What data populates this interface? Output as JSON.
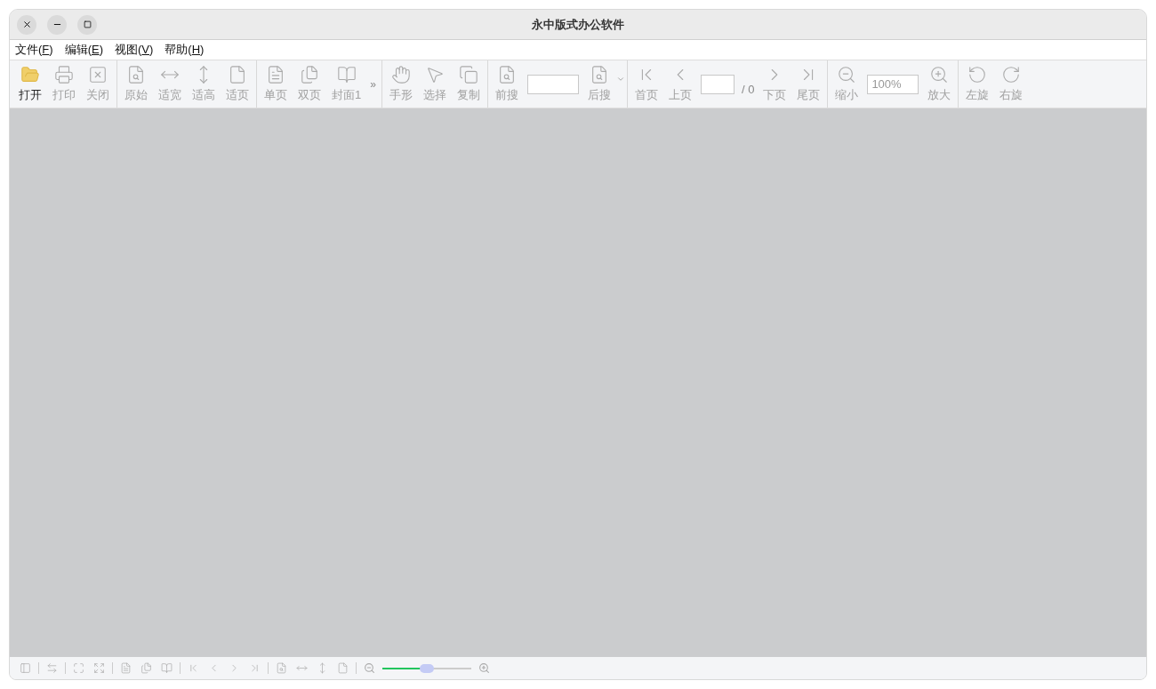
{
  "window": {
    "title": "永中版式办公软件"
  },
  "menu": [
    {
      "label": "文件(",
      "mnemonic": "F",
      "tail": ")"
    },
    {
      "label": "编辑(",
      "mnemonic": "E",
      "tail": ")"
    },
    {
      "label": "视图(",
      "mnemonic": "V",
      "tail": ")"
    },
    {
      "label": "帮助(",
      "mnemonic": "H",
      "tail": ")"
    }
  ],
  "toolbar": [
    [
      {
        "kind": "button",
        "label": "打开",
        "disabled": false
      },
      {
        "kind": "button",
        "label": "打印",
        "disabled": true
      },
      {
        "kind": "button",
        "label": "关闭",
        "disabled": true
      }
    ],
    [
      {
        "kind": "button",
        "label": "原始",
        "disabled": true
      },
      {
        "kind": "button",
        "label": "适宽",
        "disabled": true
      },
      {
        "kind": "button",
        "label": "适高",
        "disabled": true
      },
      {
        "kind": "button",
        "label": "适页",
        "disabled": true
      }
    ],
    [
      {
        "kind": "button",
        "label": "单页",
        "disabled": true
      },
      {
        "kind": "button",
        "label": "双页",
        "disabled": true
      },
      {
        "kind": "button",
        "label": "封面1",
        "disabled": true
      },
      {
        "kind": "more",
        "label": "»"
      }
    ],
    [
      {
        "kind": "button",
        "label": "手形",
        "disabled": true
      },
      {
        "kind": "button",
        "label": "选择",
        "disabled": true
      },
      {
        "kind": "button",
        "label": "复制",
        "disabled": true
      }
    ],
    [
      {
        "kind": "button",
        "label": "前搜",
        "disabled": true
      },
      {
        "kind": "field"
      },
      {
        "kind": "button",
        "label": "后搜",
        "disabled": true
      },
      {
        "kind": "dropdown"
      }
    ],
    [
      {
        "kind": "button",
        "label": "首页",
        "disabled": true
      },
      {
        "kind": "button",
        "label": "上页",
        "disabled": true
      },
      {
        "kind": "field"
      },
      {
        "kind": "text",
        "label": "/ 0"
      },
      {
        "kind": "button",
        "label": "下页",
        "disabled": true
      },
      {
        "kind": "button",
        "label": "尾页",
        "disabled": true
      }
    ],
    [
      {
        "kind": "button",
        "label": "缩小",
        "disabled": true
      },
      {
        "kind": "field",
        "value": "100%"
      },
      {
        "kind": "button",
        "label": "放大",
        "disabled": true
      }
    ],
    [
      {
        "kind": "button",
        "label": "左旋",
        "disabled": true
      },
      {
        "kind": "button",
        "label": "右旋",
        "disabled": true
      }
    ]
  ],
  "status_bar": {
    "zoom_slider": {
      "level": 0.5
    }
  }
}
